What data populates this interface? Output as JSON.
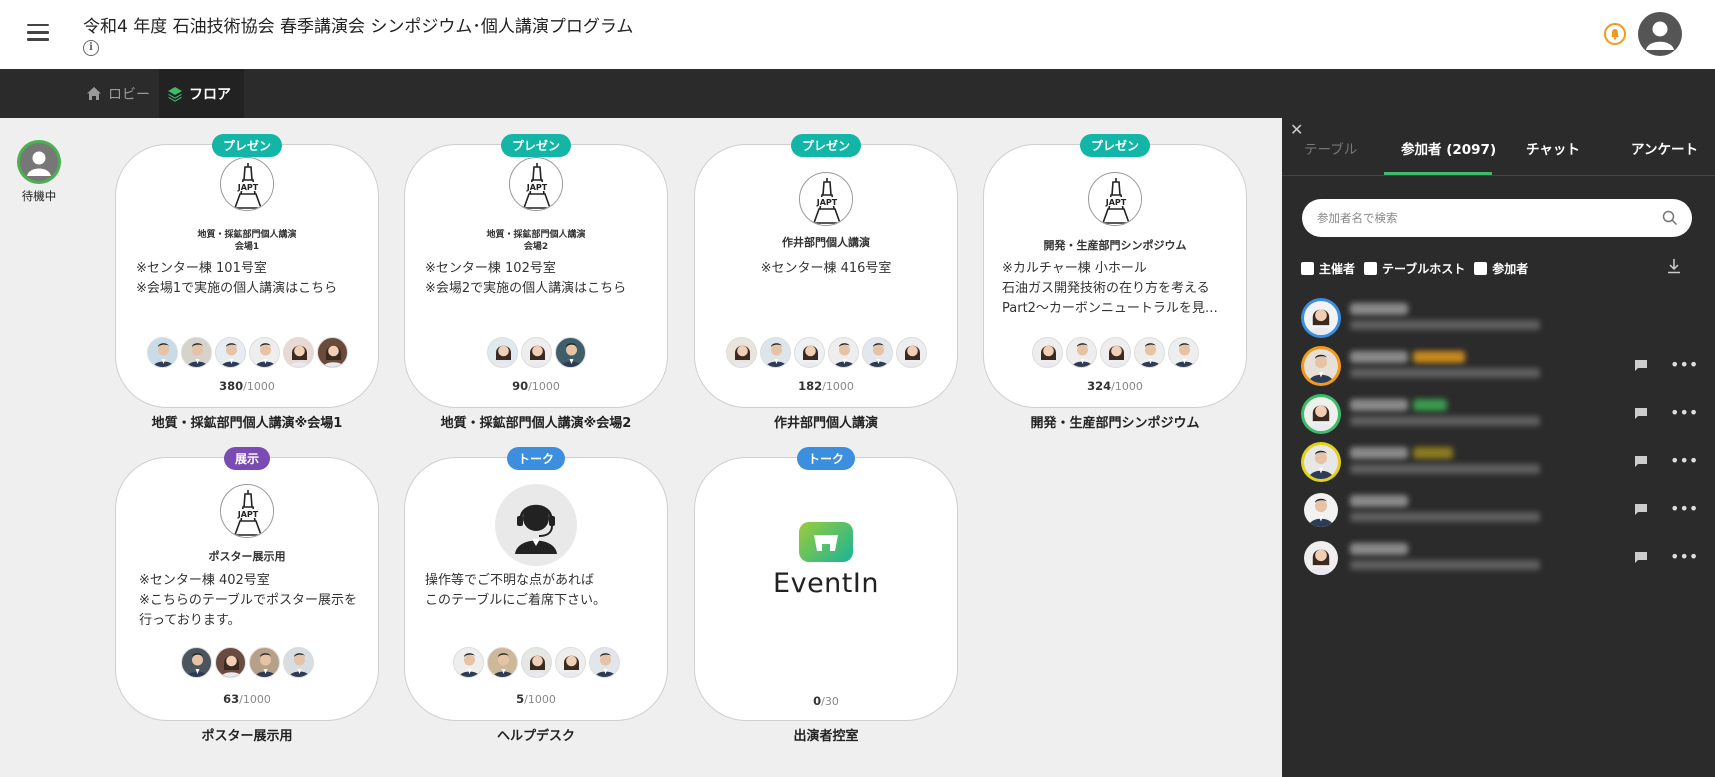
{
  "header": {
    "title": "令和4 年度  石油技術協会  春季講演会 シンポジウム･個人講演プログラム"
  },
  "nav": {
    "lobby": "ロビー",
    "floor": "フロア"
  },
  "standby": {
    "label": "待機中"
  },
  "tables": [
    {
      "tag": "プレゼン",
      "sub1": "地質・採鉱部門個人講演",
      "sub2": "会場1",
      "desc": "※センター棟 101号室\n   ※会場1で実施の個人講演はこちら",
      "count": "380",
      "capacity": "/1000",
      "label": "地質・採鉱部門個人講演※会場1"
    },
    {
      "tag": "プレゼン",
      "sub1": "地質・採鉱部門個人講演",
      "sub2": "会場2",
      "desc": "※センター棟 102号室\n   ※会場2で実施の個人講演はこちら",
      "count": "90",
      "capacity": "/1000",
      "label": "地質・採鉱部門個人講演※会場2"
    },
    {
      "tag": "プレゼン",
      "sub1": "作井部門個人講演",
      "desc": "※センター棟 416号室",
      "count": "182",
      "capacity": "/1000",
      "label": "作井部門個人講演"
    },
    {
      "tag": "プレゼン",
      "sub1": "開発・生産部門シンポジウム",
      "desc": "※カルチャー棟 小ホール\n石油ガス開発技術の在り方を考える\n Part2～カーボンニュートラルを見…",
      "count": "324",
      "capacity": "/1000",
      "label": "開発・生産部門シンポジウム"
    },
    {
      "tag": "展示",
      "sub1": "ポスター展示用",
      "desc": "※センター棟 402号室\n※こちらのテーブルでポスター展示を\n行っております。",
      "count": "63",
      "capacity": "/1000",
      "label": "ポスター展示用"
    },
    {
      "tag": "トーク",
      "desc": "操作等でご不明な点があれば\n    このテーブルにご着席下さい。",
      "count": "5",
      "capacity": "/1000",
      "label": "ヘルプデスク"
    },
    {
      "tag": "トーク",
      "logo_text": "EventIn",
      "count": "0",
      "capacity": "/30",
      "label": "出演者控室"
    }
  ],
  "panel": {
    "tabs": [
      "テーブル",
      "参加者 (2097)",
      "チャット",
      "アンケート"
    ],
    "active_tab": "参加者 (2097)",
    "search_placeholder": "参加者名で検索",
    "filters": [
      "主催者",
      "テーブルホスト",
      "参加者"
    ]
  },
  "colors": {
    "present_tag": "#12b5a6",
    "exhibit_tag": "#7b4bb3",
    "talk_tag": "#3b8fde",
    "active_tab_underline": "#3dbb6b",
    "bell": "#f29a1a"
  }
}
